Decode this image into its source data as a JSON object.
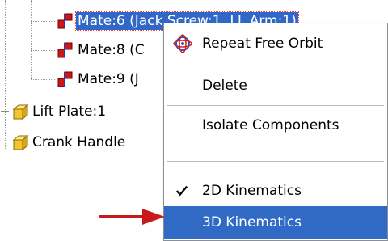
{
  "tree": {
    "mate6": {
      "label": "Mate:6 (Jack Screw:1, LL Arm:1)"
    },
    "mate8": {
      "label": "Mate:8 (C"
    },
    "mate9": {
      "label": "Mate:9 (J"
    },
    "lift_plate": {
      "label": "Lift Plate:1"
    },
    "crank_handle": {
      "label": "Crank Handle"
    }
  },
  "context_menu": {
    "repeat_free_orbit": {
      "mnemonic": "R",
      "rest": "epeat Free Orbit"
    },
    "delete": {
      "mnemonic": "D",
      "rest": "elete"
    },
    "isolate_components": "Isolate Components",
    "kinematics_2d": {
      "label": "2D Kinematics",
      "checked": true
    },
    "kinematics_3d": {
      "label": "3D Kinematics",
      "highlighted": true
    }
  },
  "colors": {
    "selection": "#3168c8",
    "menu_highlight": "#316ac5",
    "arrow": "#c8191e",
    "mate_icon_red": "#d01515",
    "mate_icon_blue": "#1a3fbf",
    "part_icon_yellow": "#f4c430"
  },
  "icons": {
    "mate": "mate-constraint-icon",
    "part": "part-cube-icon",
    "orbit": "free-orbit-icon",
    "check": "check-mark-icon",
    "arrow": "red-arrow"
  }
}
